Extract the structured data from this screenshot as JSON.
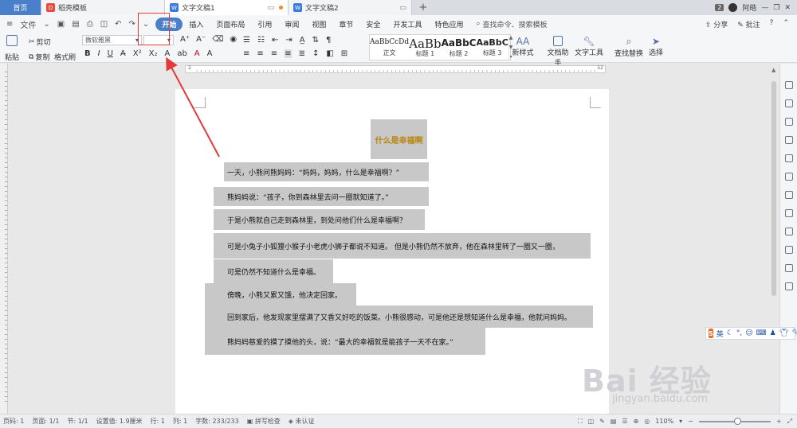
{
  "tabs": {
    "home": "首页",
    "docs": [
      {
        "title": "稻壳模板",
        "icon": "daoke-icon"
      },
      {
        "title": "文字文稿1",
        "icon": "wps-writer-icon",
        "active": true,
        "unsaved": true
      },
      {
        "title": "文字文稿2",
        "icon": "wps-writer-icon"
      }
    ],
    "page_count_badge": "2",
    "user_name": "阿皓"
  },
  "menu": {
    "file": "文件",
    "items": [
      "开始",
      "插入",
      "页面布局",
      "引用",
      "审阅",
      "视图",
      "章节",
      "安全",
      "开发工具",
      "特色应用"
    ],
    "active": "开始",
    "search_placeholder": "查找命令、搜索模板",
    "share": "分享",
    "comment": "批注"
  },
  "ribbon": {
    "paste": "粘贴",
    "cut": "剪切",
    "copy": "复制",
    "format_painter": "格式刷",
    "font_name": "微软雅黑",
    "font_size": "",
    "bold": "B",
    "italic": "I",
    "underline": "U",
    "styles": [
      {
        "preview": "AaBbCcDd",
        "name": "正文"
      },
      {
        "preview": "AaBb",
        "name": "标题 1"
      },
      {
        "preview": "AaBbC",
        "name": "标题 2"
      },
      {
        "preview": "AaBbC",
        "name": "标题 3"
      }
    ],
    "new_style": "新样式",
    "doc_helper": "文档助手",
    "text_tools": "文字工具",
    "find_replace": "查找替换",
    "select": "选择"
  },
  "ruler": {
    "left": "2",
    "right": "52"
  },
  "document": {
    "title": "什么是幸福啊",
    "paragraphs": [
      "一天，小熊问熊妈妈：“妈妈，妈妈，什么是幸福啊？”",
      "熊妈妈说：“孩子，你到森林里去问一圈就知道了。”",
      "于是小熊就自己走到森林里，到处问他们什么是幸福啊？",
      "可是小兔子小狐狸小猴子小老虎小狮子都说不知道。  但是小熊仍然不放弃，他在森林里转了一圈又一圈，",
      "可是仍然不知道什么是幸福。",
      "傍晚，小熊又累又饿，他决定回家。",
      "回到家后，他发现家里摆满了又香又好吃的饭菜。小熊很感动，可是他还是想知道什么是幸福，他就问妈妈。",
      "熊妈妈慈爱的摸了摸他的头，说：“最大的幸福就是能孩子一天不在家。”"
    ]
  },
  "ime": {
    "lang": "英",
    "logo": "S"
  },
  "watermark": {
    "main": "Bai 经验",
    "sub": "jingyan.baidu.com"
  },
  "status": {
    "page_num": "页码: 1",
    "page": "页面: 1/1",
    "section": "节: 1/1",
    "position": "设置值: 1.9厘米",
    "row": "行: 1",
    "col": "列: 1",
    "word_count": "字数: 233/233",
    "spell": "拼写检查",
    "cert": "未认证",
    "zoom": "110%"
  },
  "colors": {
    "accent": "#4a7fc9",
    "highlight_box": "#e23b3b",
    "selection": "#c8c8c8",
    "title_text": "#b8860b"
  }
}
